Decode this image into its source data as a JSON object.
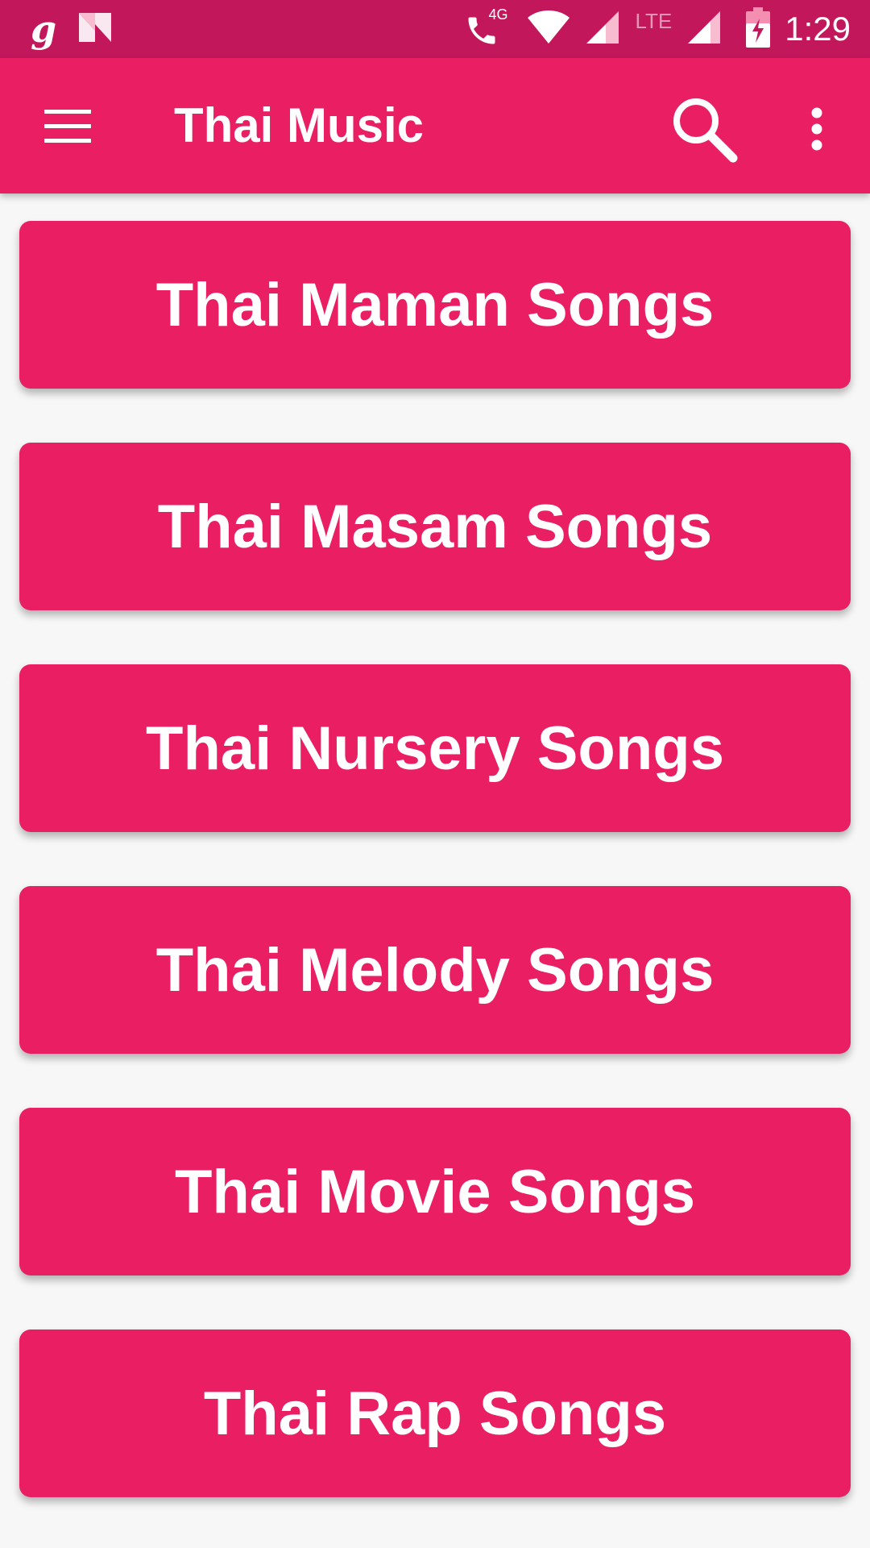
{
  "status_bar": {
    "time": "1:29",
    "left_icons": [
      "g-app-icon",
      "n-app-icon"
    ],
    "network_label": "4G",
    "lte_label": "LTE"
  },
  "app_bar": {
    "title": "Thai Music",
    "color": "#e91e63"
  },
  "categories": [
    {
      "label": "Thai Maman Songs"
    },
    {
      "label": "Thai Masam Songs"
    },
    {
      "label": "Thai Nursery Songs"
    },
    {
      "label": "Thai Melody Songs"
    },
    {
      "label": "Thai Movie Songs"
    },
    {
      "label": "Thai Rap Songs"
    }
  ],
  "colors": {
    "status_bar": "#c2185b",
    "accent": "#e91e63",
    "background": "#f7f7f7"
  }
}
